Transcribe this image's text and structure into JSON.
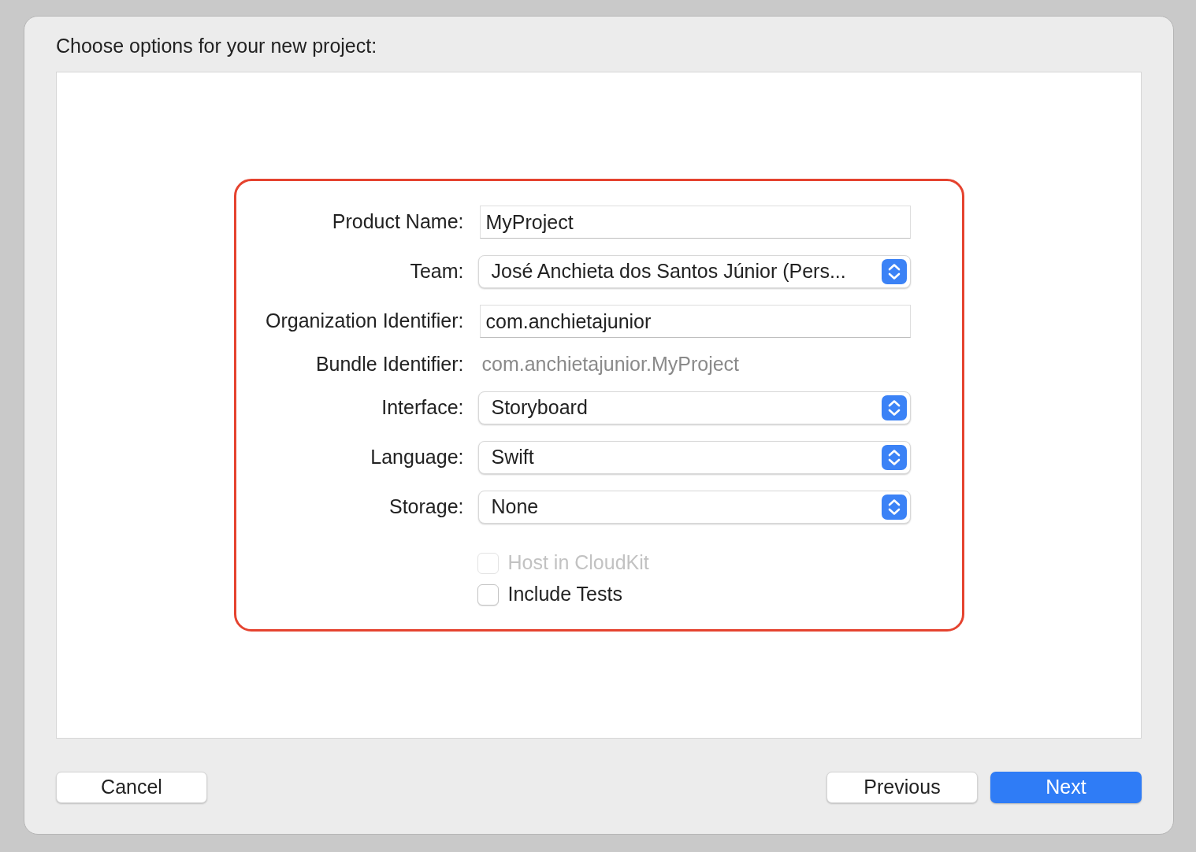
{
  "dialog": {
    "title": "Choose options for your new project:"
  },
  "fields": [
    {
      "kind": "text",
      "label": "Product Name:",
      "value": "MyProject"
    },
    {
      "kind": "popup",
      "label": "Team:",
      "value": "José Anchieta dos Santos Júnior (Pers..."
    },
    {
      "kind": "text",
      "label": "Organization Identifier:",
      "value": "com.anchietajunior"
    },
    {
      "kind": "static",
      "label": "Bundle Identifier:",
      "value": "com.anchietajunior.MyProject"
    },
    {
      "kind": "popup",
      "label": "Interface:",
      "value": "Storyboard"
    },
    {
      "kind": "popup",
      "label": "Language:",
      "value": "Swift"
    },
    {
      "kind": "popup",
      "label": "Storage:",
      "value": "None"
    }
  ],
  "checkboxes": [
    {
      "label": "Host in CloudKit",
      "checked": false,
      "disabled": true
    },
    {
      "label": "Include Tests",
      "checked": false,
      "disabled": false
    }
  ],
  "buttons": [
    {
      "label": "Cancel",
      "kind": "plain"
    },
    {
      "label": "Previous",
      "kind": "plain"
    },
    {
      "label": "Next",
      "kind": "default"
    }
  ]
}
